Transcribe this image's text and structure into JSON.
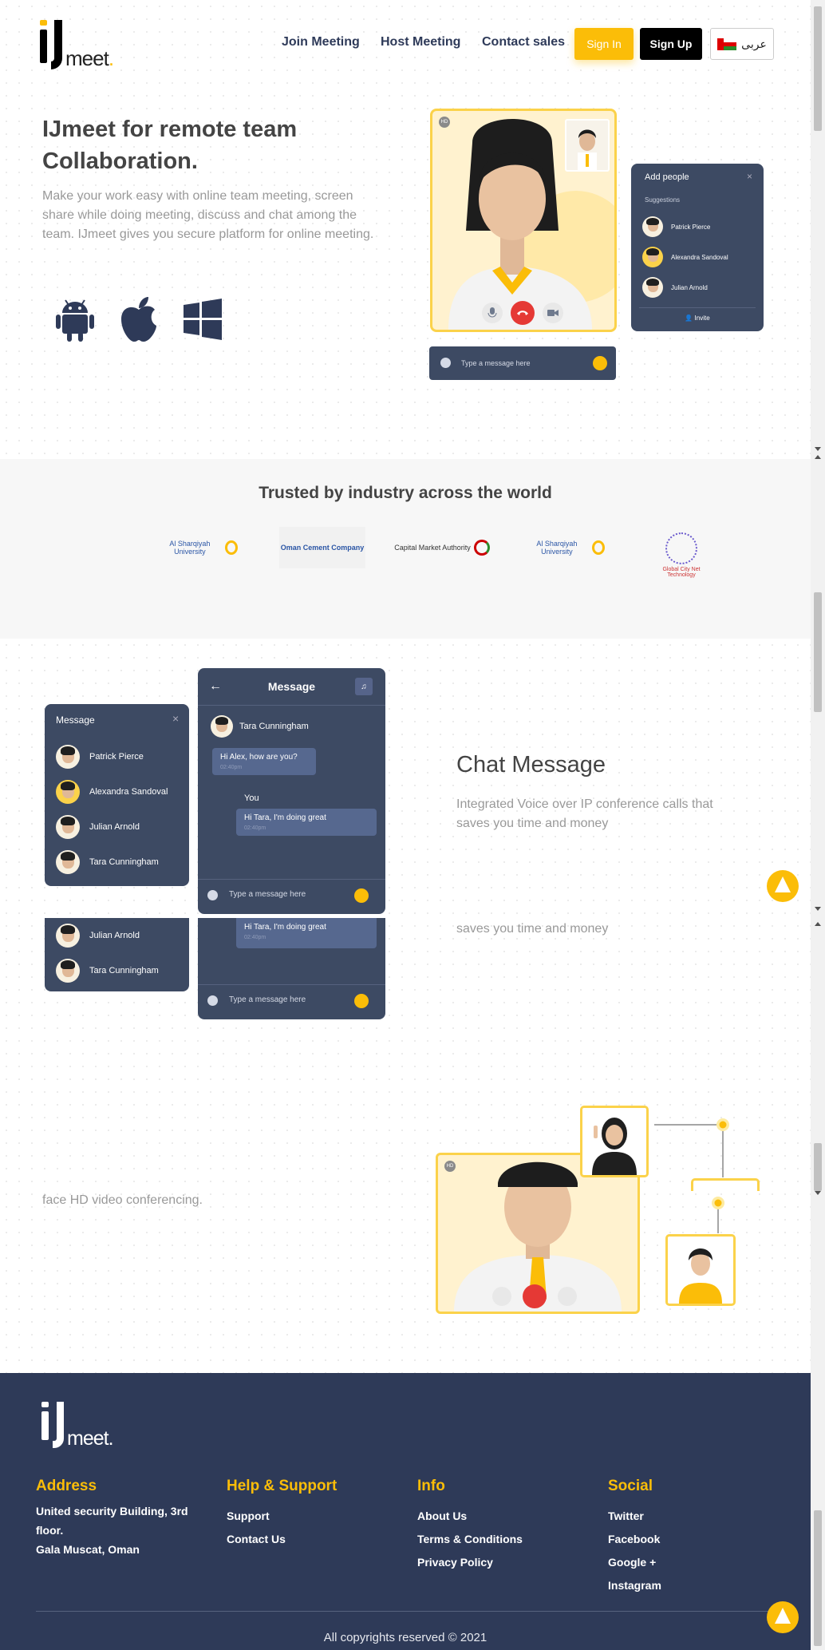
{
  "header": {
    "logo_text": "meet",
    "nav": [
      "Join Meeting",
      "Host Meeting",
      "Contact sales"
    ],
    "sign_in": "Sign In",
    "sign_up": "Sign Up",
    "language": "عربى"
  },
  "hero": {
    "title": "IJmeet for remote team Collaboration.",
    "description": "Make your work easy with online team meeting, screen share while doing meeting, discuss and chat among the team. IJmeet gives you secure platform for online meeting.",
    "platforms": [
      "android-icon",
      "apple-icon",
      "windows-icon"
    ],
    "video_card": {
      "badge": "HD"
    },
    "add_people": {
      "title": "Add people",
      "subtitle": "Suggestions",
      "people": [
        "Patrick Pierce",
        "Alexandra Sandoval",
        "Julian Arnold"
      ],
      "invite": "Invite"
    },
    "message_placeholder": "Type a message here"
  },
  "trusted": {
    "title": "Trusted by industry across the world",
    "logos": [
      "Al Sharqiyah University",
      "Oman Cement Company",
      "Capital Market Authority",
      "Al Sharqiyah University",
      "Global City Net Technology"
    ]
  },
  "chat": {
    "title": "Chat Message",
    "description": "Integrated Voice over IP conference calls that saves you time and money",
    "description_repeat": "saves you time and money",
    "list_panel": {
      "title": "Message",
      "people": [
        "Patrick Pierce",
        "Alexandra Sandoval",
        "Julian Arnold",
        "Tara Cunningham"
      ]
    },
    "conversation": {
      "title": "Message",
      "contact": "Tara Cunningham",
      "incoming": "Hi Alex, how are you?",
      "incoming_time": "02:40pm",
      "you_label": "You",
      "outgoing": "Hi Tara, I'm doing great",
      "outgoing_time": "02:40pm",
      "placeholder": "Type a message here"
    },
    "repeat_panel": {
      "people": [
        "Julian Arnold",
        "Tara Cunningham"
      ],
      "outgoing": "Hi Tara, I'm doing great",
      "outgoing_time": "02:40pm",
      "placeholder": "Type a message here"
    }
  },
  "video": {
    "description": "face HD video conferencing.",
    "badge": "HD"
  },
  "footer": {
    "logo_text": "meet",
    "address": {
      "title": "Address",
      "lines": [
        "United security Building, 3rd",
        "floor.",
        "Gala Muscat, Oman"
      ]
    },
    "help": {
      "title": "Help & Support",
      "links": [
        "Support",
        "Contact Us"
      ]
    },
    "info": {
      "title": "Info",
      "links": [
        "About Us",
        "Terms & Conditions",
        "Privacy Policy"
      ]
    },
    "social": {
      "title": "Social",
      "links": [
        "Twitter",
        "Facebook",
        "Google +",
        "Instagram"
      ]
    },
    "copyright": "All copyrights reserved © 2021"
  },
  "colors": {
    "accent": "#fbbd08",
    "navy": "#2e3a58",
    "panel": "#3d4a63"
  }
}
